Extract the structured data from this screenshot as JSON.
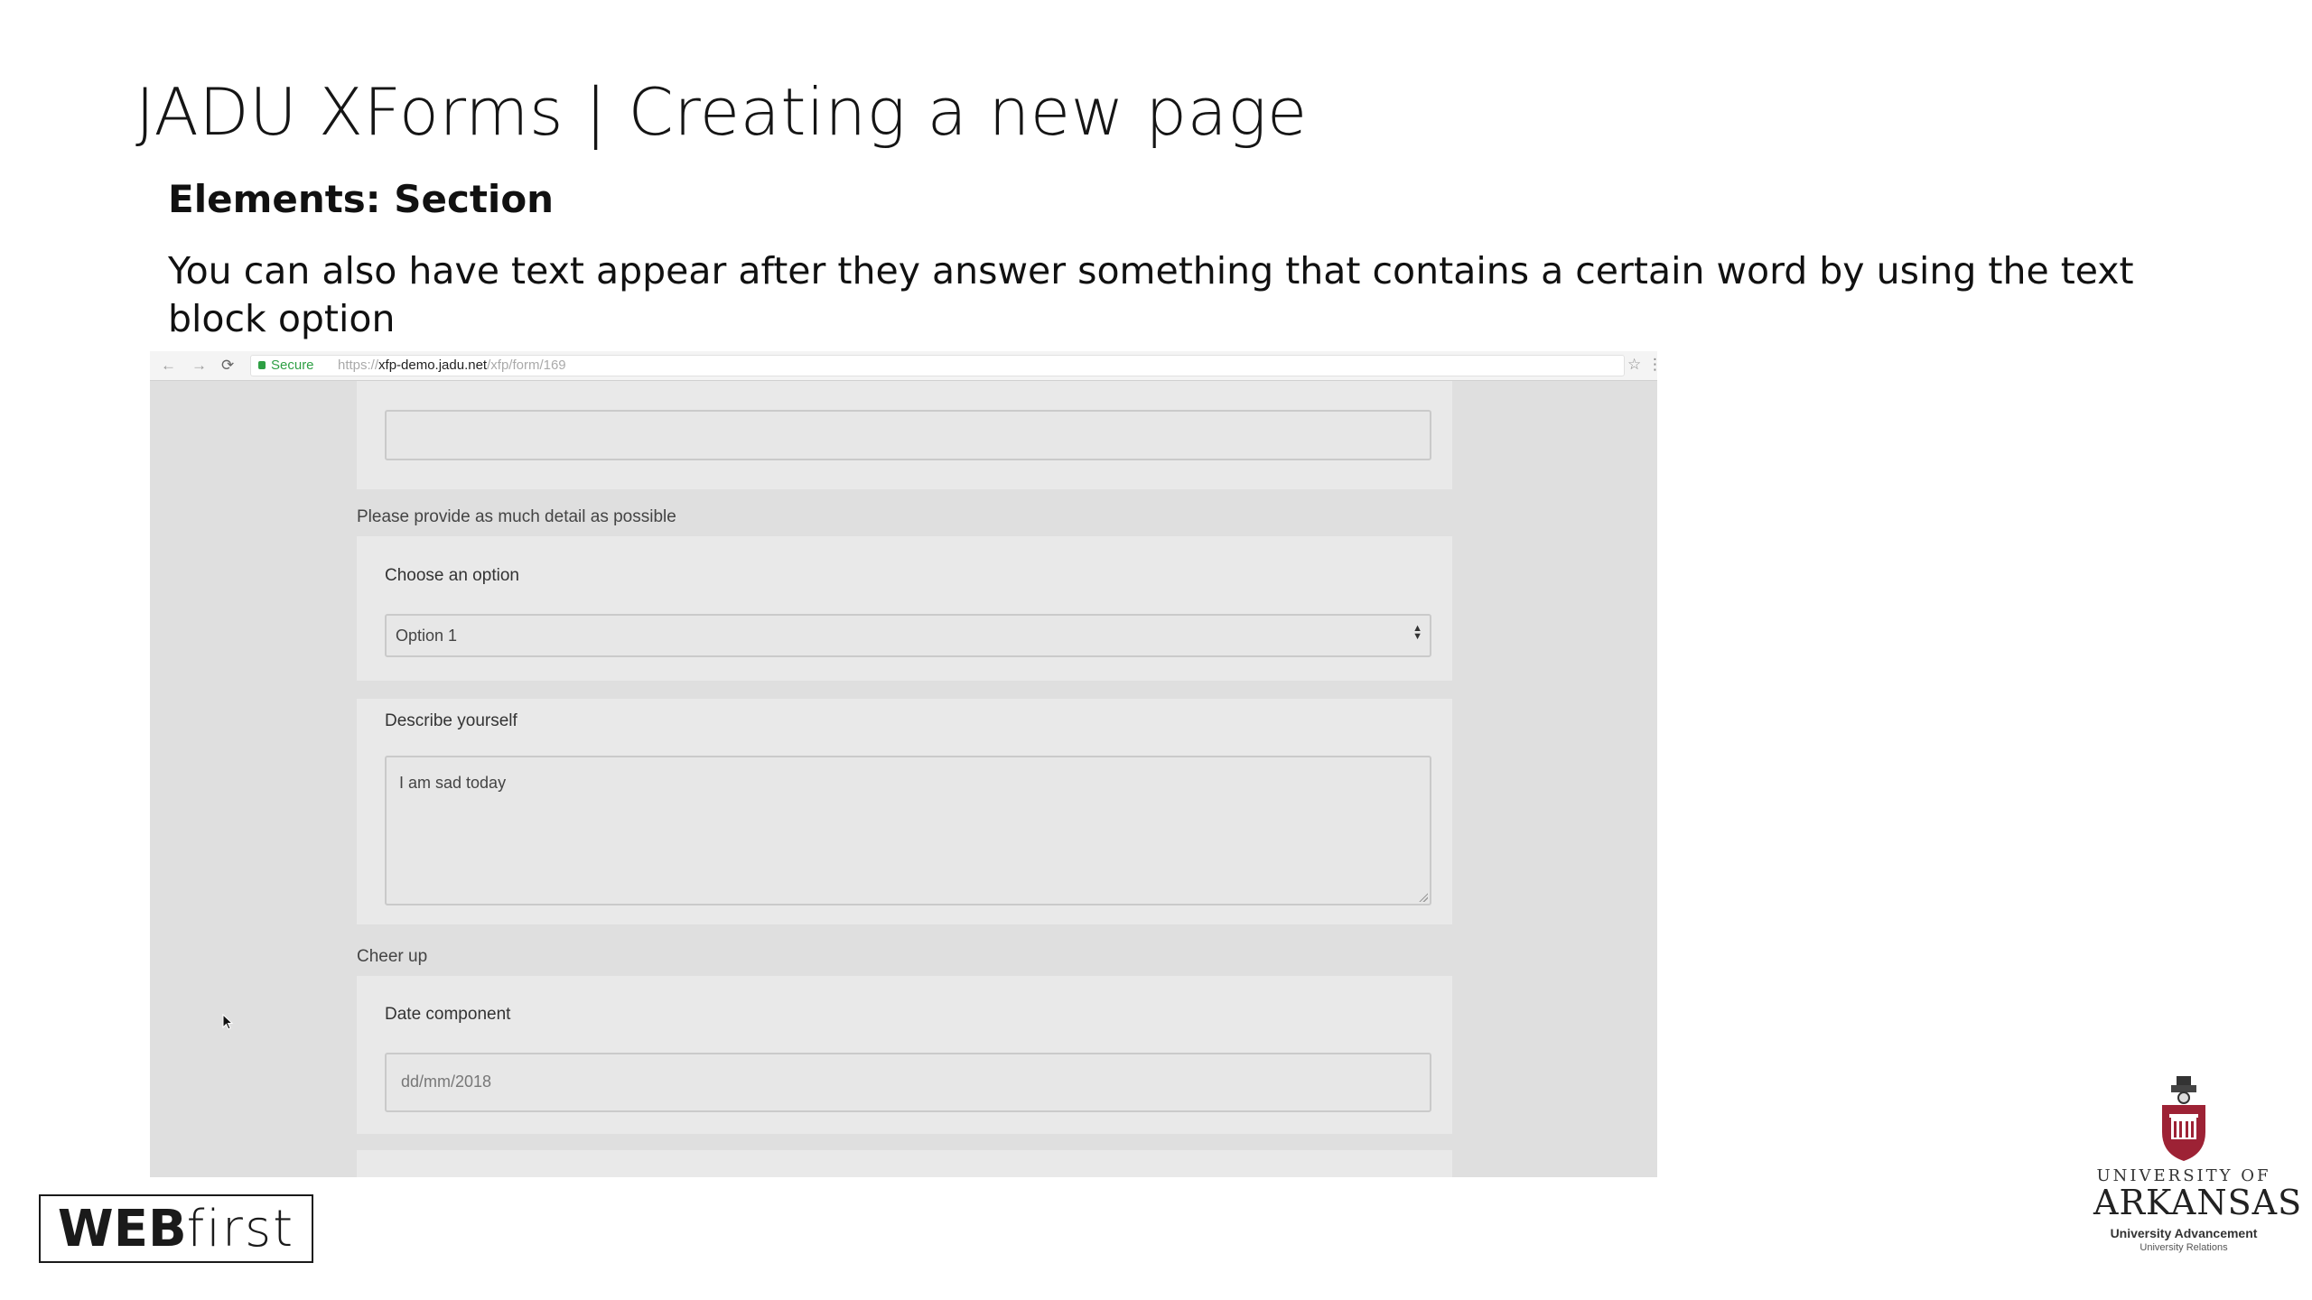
{
  "slide": {
    "title": "JADU XForms | Creating a new page",
    "section_heading": "Elements: Section",
    "body": "You can also have text appear after they answer something that contains a certain word by using the text block option"
  },
  "browser": {
    "back_icon": "back-arrow-icon",
    "forward_icon": "forward-arrow-icon",
    "reload_icon": "reload-icon",
    "secure_label": "Secure",
    "url_scheme": "https://",
    "url_host": "xfp-demo.jadu.net",
    "url_path": "/xfp/form/169",
    "star_icon": "bookmark-star-icon",
    "menu_icon": "kebab-menu-icon"
  },
  "form": {
    "top_input_value": "",
    "helper_text": "Please provide as much detail as possible",
    "choose_label": "Choose an option",
    "choose_selected": "Option 1",
    "describe_label": "Describe yourself",
    "describe_value": "I am sad today",
    "text_block": "Cheer up",
    "date_label": "Date component",
    "date_value": "dd/mm/2018"
  },
  "footer": {
    "webfirst_web": "WEB",
    "webfirst_first": "first",
    "ua_university": "UNIVERSITY OF",
    "ua_arkansas": "ARKANSAS",
    "ua_advancement": "University Advancement",
    "ua_relations": "University Relations"
  },
  "colors": {
    "ua_cardinal": "#9d2235",
    "secure_green": "#2e9f44"
  }
}
